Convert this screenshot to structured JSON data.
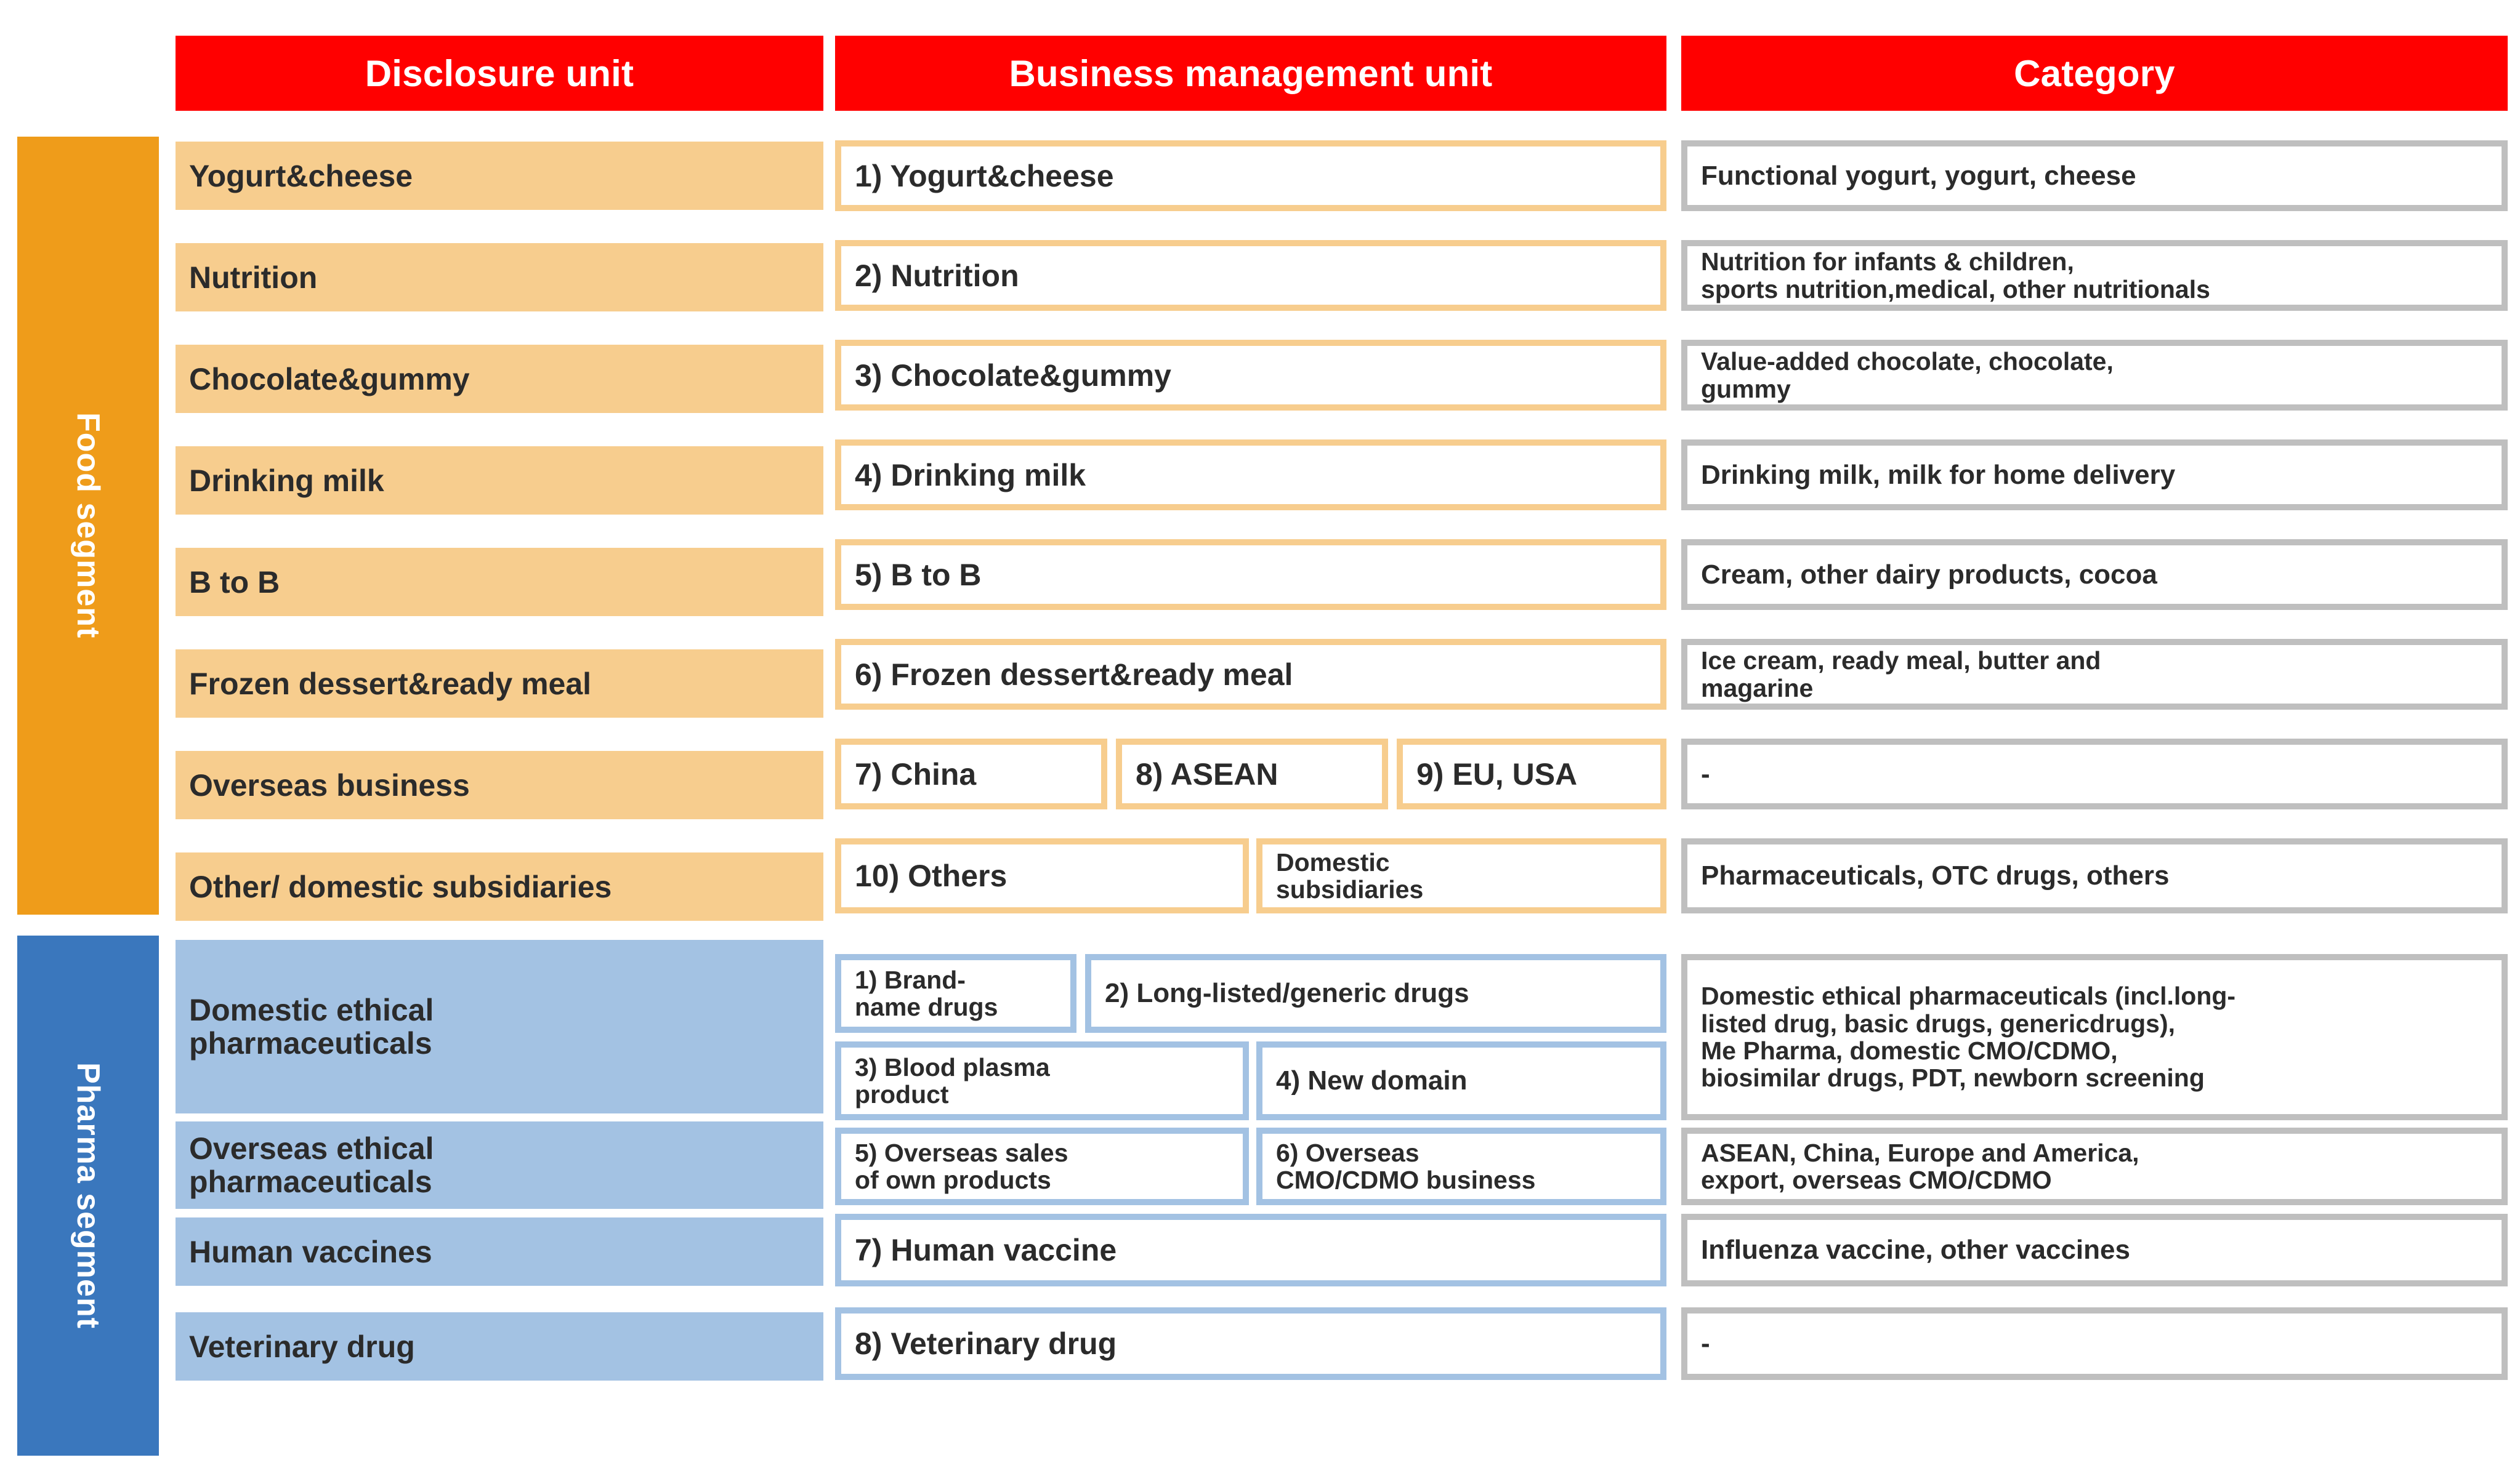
{
  "headers": {
    "col1": "Disclosure unit",
    "col2": "Business management unit",
    "col3": "Category"
  },
  "segments": {
    "food": "Food segment",
    "pharma": "Pharma segment"
  },
  "colors": {
    "header_red": "#ff0000",
    "food_rail": "#ef9c1a",
    "food_fill": "#f7cd8e",
    "pharma_rail": "#3a77bd",
    "pharma_fill": "#a3c2e3",
    "category_border": "#bfbfbf",
    "text": "#2b2b2b"
  },
  "food_rows": [
    {
      "disclosure": "Yogurt&cheese",
      "units": [
        "1) Yogurt&cheese"
      ],
      "category": "Functional yogurt, yogurt, cheese"
    },
    {
      "disclosure": "Nutrition",
      "units": [
        "2) Nutrition"
      ],
      "category": "Nutrition for infants & children,\nsports nutrition,medical, other nutritionals"
    },
    {
      "disclosure": "Chocolate&gummy",
      "units": [
        "3) Chocolate&gummy"
      ],
      "category": "Value-added chocolate,  chocolate,\ngummy"
    },
    {
      "disclosure": "Drinking milk",
      "units": [
        "4) Drinking milk"
      ],
      "category": "Drinking milk, milk for home delivery"
    },
    {
      "disclosure": "B to B",
      "units": [
        "5) B to B"
      ],
      "category": "Cream, other dairy products, cocoa"
    },
    {
      "disclosure": "Frozen dessert&ready meal",
      "units": [
        "6) Frozen dessert&ready meal"
      ],
      "category": "Ice cream, ready meal, butter and\nmagarine"
    },
    {
      "disclosure": "Overseas business",
      "units": [
        "7) China",
        "8) ASEAN",
        "9) EU, USA"
      ],
      "category": "-"
    },
    {
      "disclosure": "Other/ domestic subsidiaries",
      "units": [
        "10) Others",
        "Domestic\nsubsidiaries"
      ],
      "category": "Pharmaceuticals, OTC drugs, others"
    }
  ],
  "pharma_rows": [
    {
      "disclosure": "Domestic ethical\npharmaceuticals",
      "units": [
        "1) Brand-\nname drugs",
        "2) Long-listed/generic drugs",
        "3) Blood plasma\nproduct",
        "4) New domain"
      ],
      "category": "Domestic ethical pharmaceuticals (incl.long-\nlisted drug, basic drugs, genericdrugs),\nMe Pharma, domestic CMO/CDMO,\nbiosimilar drugs, PDT, newborn screening"
    },
    {
      "disclosure": "Overseas ethical\npharmaceuticals",
      "units": [
        "5) Overseas sales\n of own products",
        "6) Overseas\nCMO/CDMO business"
      ],
      "category": "ASEAN, China, Europe and America,\nexport, overseas CMO/CDMO"
    },
    {
      "disclosure": "Human vaccines",
      "units": [
        "7) Human vaccine"
      ],
      "category": "Influenza vaccine, other vaccines"
    },
    {
      "disclosure": "Veterinary drug",
      "units": [
        "8) Veterinary drug"
      ],
      "category": "-"
    }
  ]
}
